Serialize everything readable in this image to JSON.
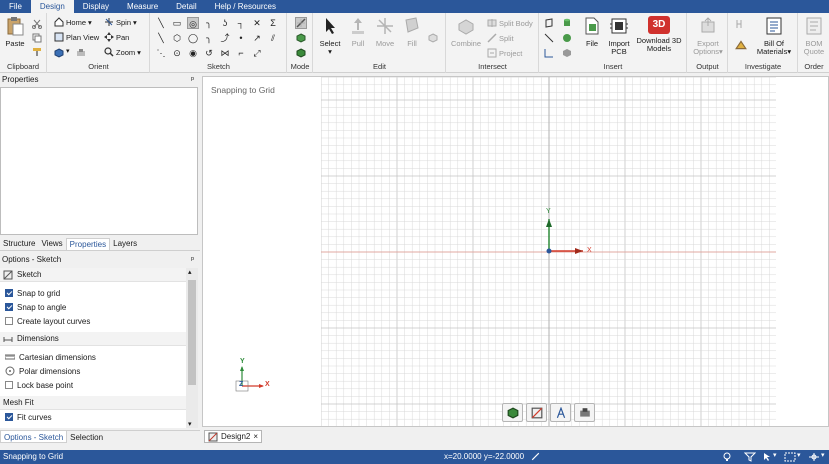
{
  "menu": {
    "tabs": [
      "File",
      "Design",
      "Display",
      "Measure",
      "Detail",
      "Help / Resources"
    ],
    "active": "Design"
  },
  "ribbon": {
    "groups": {
      "clipboard": "Clipboard",
      "orient": "Orient",
      "sketch": "Sketch",
      "mode": "Mode",
      "edit": "Edit",
      "intersect": "Intersect",
      "insert": "Insert",
      "output": "Output",
      "investigate": "Investigate",
      "order": "Order"
    },
    "paste": "Paste",
    "home": "Home",
    "spin": "Spin",
    "plan_view": "Plan View",
    "pan": "Pan",
    "zoom": "Zoom",
    "select": "Select",
    "pull": "Pull",
    "move": "Move",
    "fill": "Fill",
    "combine": "Combine",
    "split_body": "Split Body",
    "split": "Split",
    "project": "Project",
    "file": "File",
    "import_pcb": [
      "Import",
      "PCB"
    ],
    "download_3d": [
      "Download 3D",
      "Models"
    ],
    "download_badge": "3D",
    "export_options": [
      "Export",
      "Options"
    ],
    "bill_of_materials": [
      "Bill Of",
      "Materials"
    ],
    "bom_quote": [
      "BOM",
      "Quote"
    ],
    "sigma": "Σ"
  },
  "left_panel": {
    "properties_title": "Properties",
    "pin": "ᵖ",
    "tabs": [
      "Structure",
      "Views",
      "Properties",
      "Layers"
    ],
    "active_tab": "Properties",
    "options_title": "Options - Sketch",
    "sections": {
      "sketch": "Sketch",
      "dimensions": "Dimensions",
      "mesh_fit": "Mesh Fit"
    },
    "snap_to_grid": "Snap to grid",
    "snap_to_angle": "Snap to angle",
    "create_layout_curves": "Create layout curves",
    "cartesian_dimensions": "Cartesian dimensions",
    "polar_dimensions": "Polar dimensions",
    "lock_base_point": "Lock base point",
    "fit_curves": "Fit curves",
    "bottom_tabs": [
      "Options - Sketch",
      "Selection"
    ]
  },
  "viewport": {
    "label": "Snapping to Grid",
    "axis_x": "X",
    "axis_y": "Y",
    "axis_z": "Z"
  },
  "doc_tab": {
    "name": "Design2",
    "close": "×"
  },
  "status": {
    "text": "Snapping to Grid",
    "coords": "x=20.0000  y=-22.0000"
  },
  "colors": {
    "accent": "#2b579a",
    "axis_x": "#d23a2a",
    "axis_y": "#2e8b3a",
    "grid": "#d9d9d9"
  }
}
